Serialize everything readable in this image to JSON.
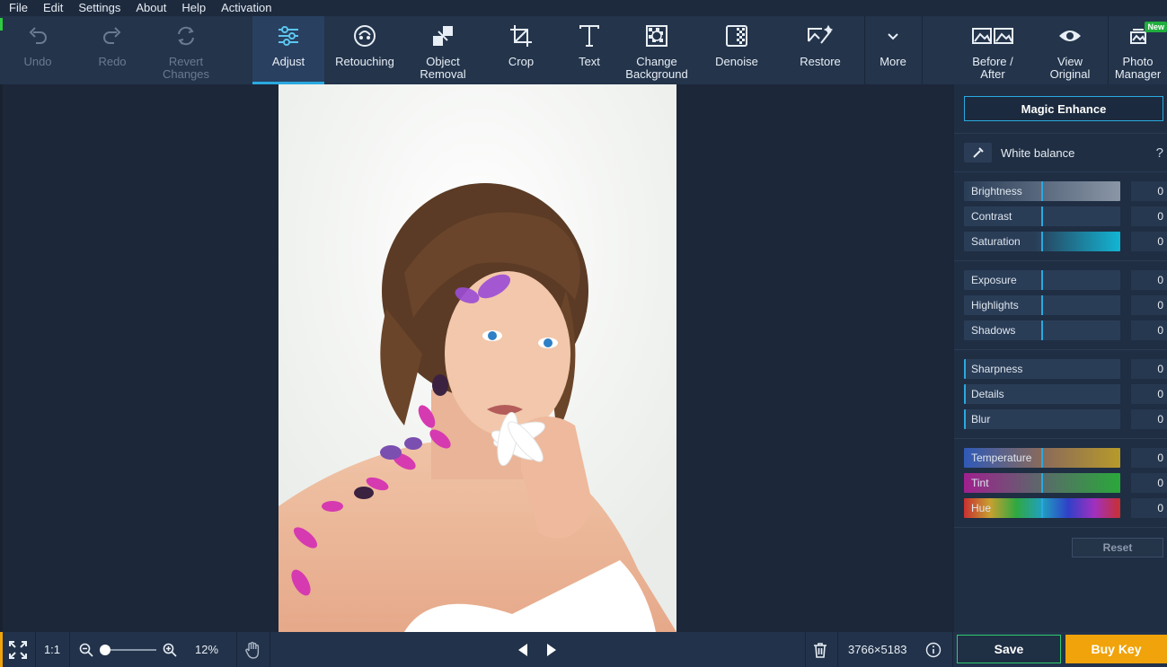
{
  "menu": [
    "File",
    "Edit",
    "Settings",
    "About",
    "Help",
    "Activation"
  ],
  "toolbar": {
    "undo": "Undo",
    "redo": "Redo",
    "revert1": "Revert",
    "revert2": "Changes",
    "adjust": "Adjust",
    "retouching": "Retouching",
    "object1": "Object",
    "object2": "Removal",
    "crop": "Crop",
    "text": "Text",
    "change1": "Change",
    "change2": "Background",
    "denoise": "Denoise",
    "restore": "Restore",
    "more": "More",
    "before1": "Before /",
    "before2": "After",
    "view1": "View",
    "view2": "Original",
    "photo1": "Photo",
    "photo2": "Manager",
    "new_badge": "New"
  },
  "panel": {
    "magic": "Magic Enhance",
    "white_balance": "White balance",
    "help": "?",
    "reset": "Reset",
    "sliders": [
      {
        "label": "Brightness",
        "value": "0"
      },
      {
        "label": "Contrast",
        "value": "0"
      },
      {
        "label": "Saturation",
        "value": "0"
      },
      {
        "label": "Exposure",
        "value": "0"
      },
      {
        "label": "Highlights",
        "value": "0"
      },
      {
        "label": "Shadows",
        "value": "0"
      },
      {
        "label": "Sharpness",
        "value": "0"
      },
      {
        "label": "Details",
        "value": "0"
      },
      {
        "label": "Blur",
        "value": "0"
      },
      {
        "label": "Temperature",
        "value": "0"
      },
      {
        "label": "Tint",
        "value": "0"
      },
      {
        "label": "Hue",
        "value": "0"
      }
    ]
  },
  "bottom": {
    "one_to_one": "1:1",
    "zoom": "12%",
    "dimensions": "3766×5183",
    "save": "Save",
    "buy": "Buy Key"
  },
  "colors": {
    "accent": "#2aa9e0",
    "buy": "#f0a30a",
    "save_border": "#2ecc71"
  }
}
